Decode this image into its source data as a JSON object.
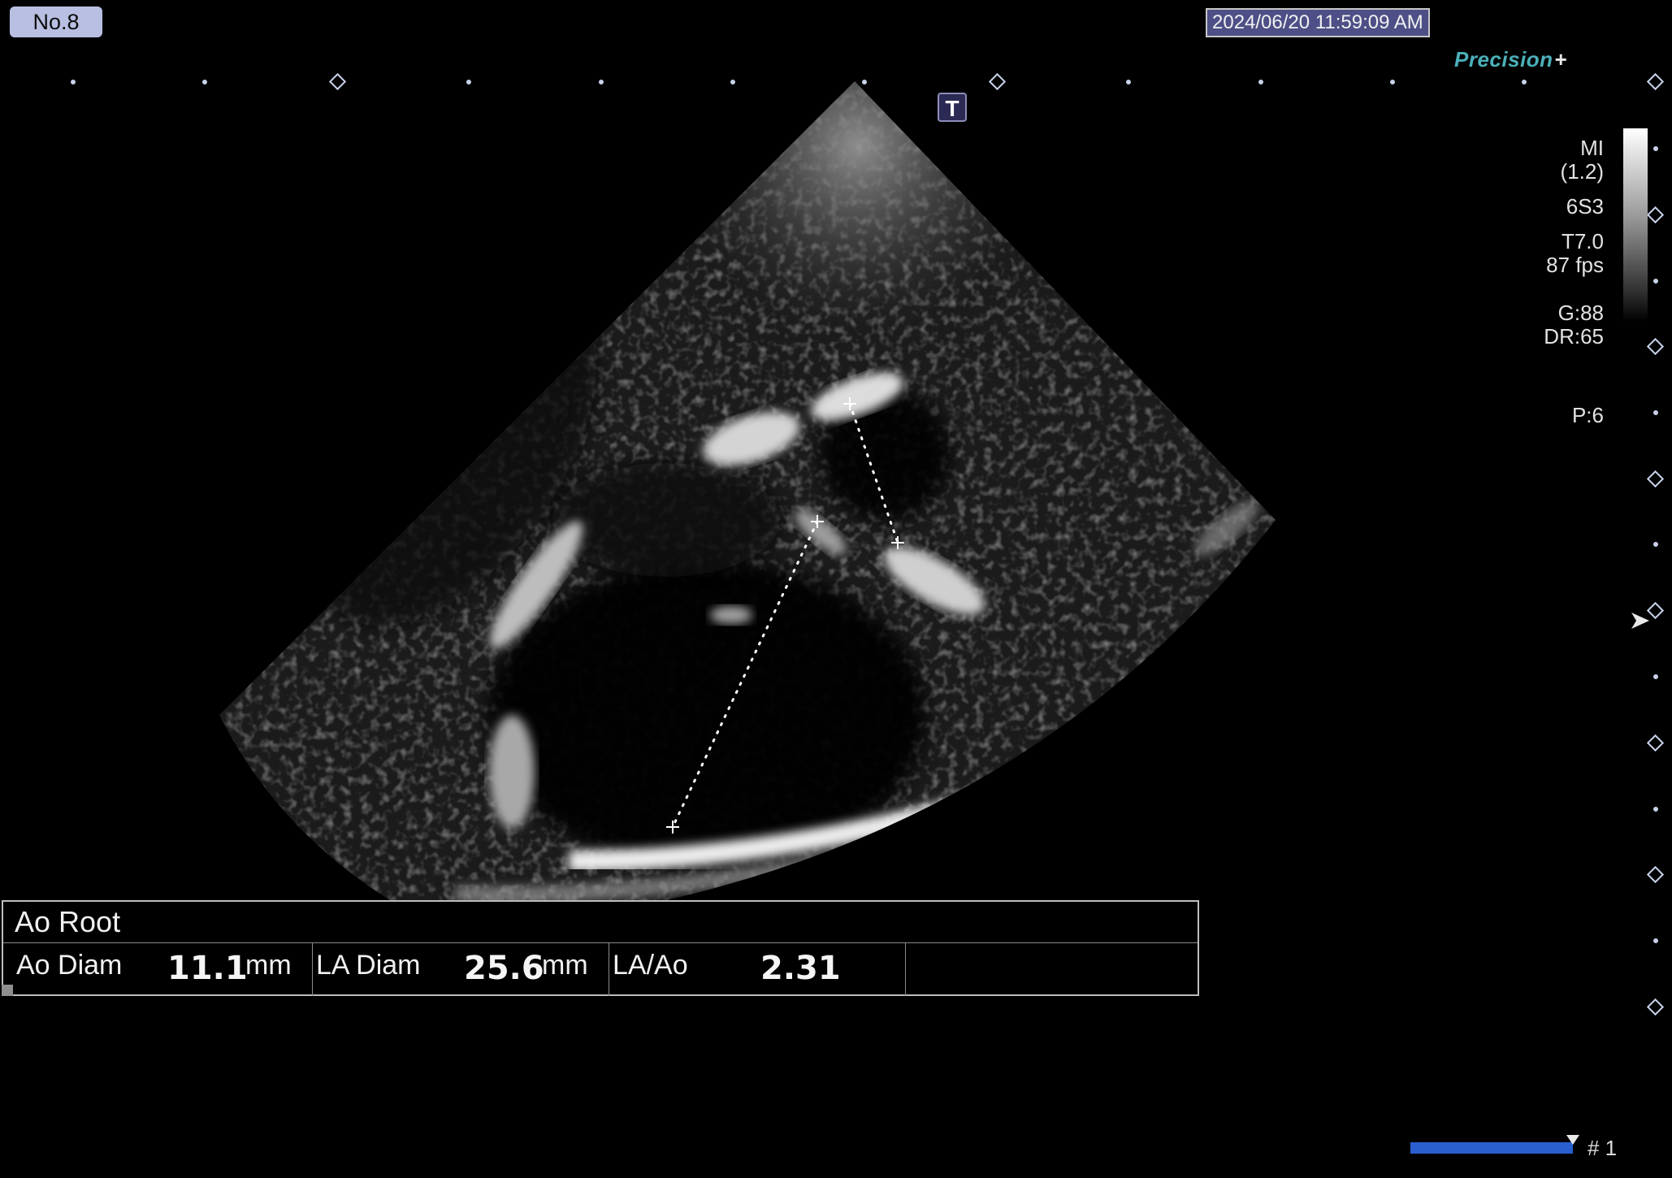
{
  "header": {
    "badge": "No.8",
    "datetime": "2024/06/20 11:59:09 AM",
    "brand": "Precision",
    "brand_suffix": "+"
  },
  "image": {
    "t_icon": "T"
  },
  "params": {
    "mi_label": "MI",
    "mi_value": "(1.2)",
    "probe": "6S3",
    "tissue": "T7.0",
    "fps": "87 fps",
    "gain": "G:88",
    "dr": "DR:65",
    "power": "P:6"
  },
  "measurement": {
    "title": "Ao Root",
    "items": [
      {
        "label": "Ao Diam",
        "value": "11.1",
        "unit": "mm"
      },
      {
        "label": "LA Diam",
        "value": "25.6",
        "unit": "mm"
      },
      {
        "label": "LA/Ao",
        "value": "2.31",
        "unit": ""
      }
    ]
  },
  "footer": {
    "frame_label": "# 1"
  },
  "colors": {
    "badge_bg": "#b9bfe2",
    "datetime_bg": "#4d4f86",
    "brand": "#4bb0b9",
    "progress": "#2a5fd0"
  },
  "icons": [
    "t-marker-icon",
    "focus-arrow-icon",
    "caliper-cross-icon"
  ]
}
